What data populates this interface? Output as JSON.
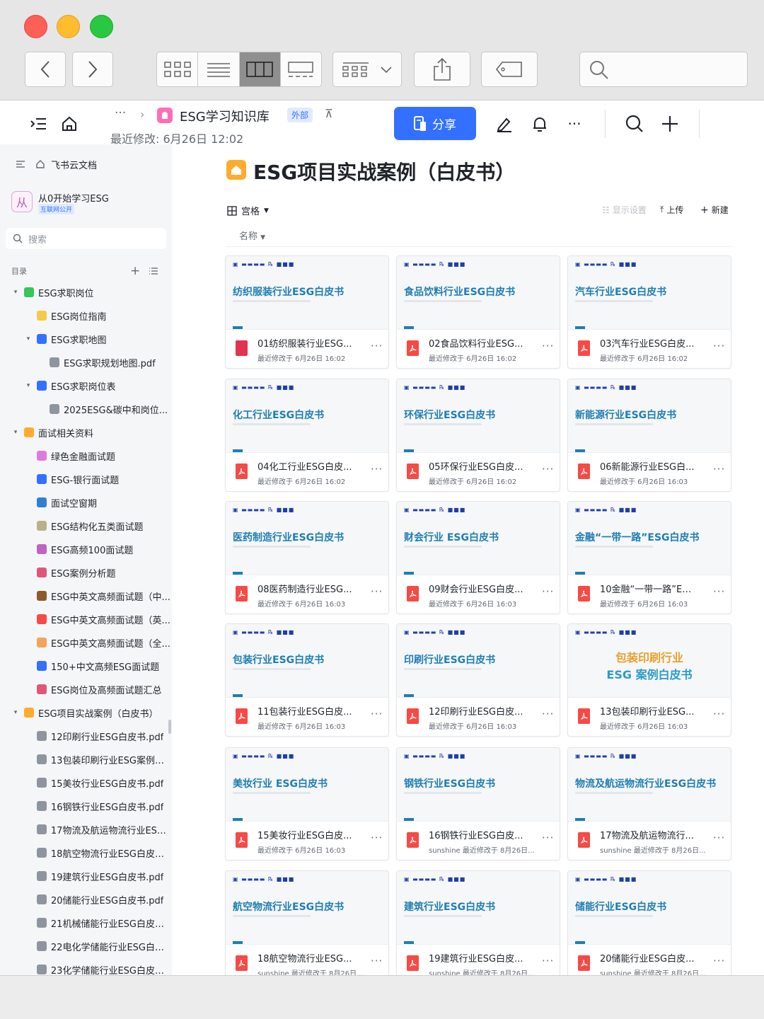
{
  "header": {
    "space_title": "ESG学习知识库",
    "external_tag": "外部",
    "last_modified": "最近修改: 6月26日 12:02",
    "share_label": "分享"
  },
  "sidebar": {
    "root_label": "飞书云文档",
    "space_name": "从0开始学习ESG",
    "space_tag": "互联网公开",
    "search_placeholder": "搜索",
    "toc_label": "目录",
    "items": [
      {
        "label": "ESG求职岗位",
        "level": 0,
        "caret": "▾",
        "color": "#34c759"
      },
      {
        "label": "ESG岗位指南",
        "level": 1,
        "caret": "",
        "color": "#f7c948"
      },
      {
        "label": "ESG求职地图",
        "level": 1,
        "caret": "▾",
        "color": "#3370ff"
      },
      {
        "label": "ESG求职规划地图.pdf",
        "level": 2,
        "caret": "",
        "color": "#8f959e"
      },
      {
        "label": "ESG求职岗位表",
        "level": 1,
        "caret": "▾",
        "color": "#3370ff"
      },
      {
        "label": "2025ESG&碳中和岗位...",
        "level": 2,
        "caret": "",
        "color": "#8f959e"
      },
      {
        "label": "面试相关资料",
        "level": 0,
        "caret": "▾",
        "color": "#ffab2e"
      },
      {
        "label": "绿色金融面试题",
        "level": 1,
        "caret": "",
        "color": "#e07bdb"
      },
      {
        "label": "ESG-银行面试题",
        "level": 1,
        "caret": "",
        "color": "#3370ff"
      },
      {
        "label": "面试空窗期",
        "level": 1,
        "caret": "",
        "color": "#2f7fd8"
      },
      {
        "label": "ESG结构化五类面试题",
        "level": 1,
        "caret": "",
        "color": "#b9b18a"
      },
      {
        "label": "ESG高频100面试题",
        "level": 1,
        "caret": "",
        "color": "#c062c4"
      },
      {
        "label": "ESG案例分析题",
        "level": 1,
        "caret": "",
        "color": "#e0567a"
      },
      {
        "label": "ESG中英文高频面试题（中...",
        "level": 1,
        "caret": "",
        "color": "#8c5a2b"
      },
      {
        "label": "ESG中英文高频面试题（英...",
        "level": 1,
        "caret": "",
        "color": "#f54a45"
      },
      {
        "label": "ESG中英文高频面试题（全...",
        "level": 1,
        "caret": "",
        "color": "#f3a35c"
      },
      {
        "label": "150+中文高频ESG面试题",
        "level": 1,
        "caret": "",
        "color": "#3370ff"
      },
      {
        "label": "ESG岗位及高频面试题汇总",
        "level": 1,
        "caret": "",
        "color": "#e0567a"
      },
      {
        "label": "ESG项目实战案例（白皮书）",
        "level": 0,
        "caret": "▾",
        "color": "#ffab2e"
      },
      {
        "label": "12印刷行业ESG白皮书.pdf",
        "level": 1,
        "caret": "",
        "color": "#8f959e"
      },
      {
        "label": "13包装印刷行业ESG案例白...",
        "level": 1,
        "caret": "",
        "color": "#8f959e"
      },
      {
        "label": "15美妆行业ESG白皮书.pdf",
        "level": 1,
        "caret": "",
        "color": "#8f959e"
      },
      {
        "label": "16钢铁行业ESG白皮书.pdf",
        "level": 1,
        "caret": "",
        "color": "#8f959e"
      },
      {
        "label": "17物流及航运物流行业ESG...",
        "level": 1,
        "caret": "",
        "color": "#8f959e"
      },
      {
        "label": "18航空物流行业ESG白皮书...",
        "level": 1,
        "caret": "",
        "color": "#8f959e"
      },
      {
        "label": "19建筑行业ESG白皮书.pdf",
        "level": 1,
        "caret": "",
        "color": "#8f959e"
      },
      {
        "label": "20储能行业ESG白皮书.pdf",
        "level": 1,
        "caret": "",
        "color": "#8f959e"
      },
      {
        "label": "21机械储能行业ESG白皮书...",
        "level": 1,
        "caret": "",
        "color": "#8f959e"
      },
      {
        "label": "22电化学储能行业ESG白皮...",
        "level": 1,
        "caret": "",
        "color": "#8f959e"
      },
      {
        "label": "23化学储能行业ESG白皮书...",
        "level": 1,
        "caret": "",
        "color": "#8f959e"
      }
    ]
  },
  "main": {
    "title": "ESG项目实战案例（白皮书）",
    "view_label": "宫格",
    "display_settings": "显示设置",
    "upload": "上传",
    "new": "新建",
    "sort_label": "名称",
    "cards": [
      {
        "preview_title": "纺织服装行业ESG白皮书",
        "name": "01纺织服装行业ESG...",
        "meta": "最近修改于 6月26日 16:02",
        "icon": "bar"
      },
      {
        "preview_title": "食品饮料行业ESG白皮书",
        "name": "02食品饮料行业ESG...",
        "meta": "最近修改于 6月26日 16:02",
        "icon": "pdf"
      },
      {
        "preview_title": "汽车行业ESG白皮书",
        "name": "03汽车行业ESG白皮...",
        "meta": "最近修改于 6月26日 16:02",
        "icon": "pdf"
      },
      {
        "preview_title": "化工行业ESG白皮书",
        "name": "04化工行业ESG白皮...",
        "meta": "最近修改于 6月26日 16:02",
        "icon": "pdf"
      },
      {
        "preview_title": "环保行业ESG白皮书",
        "name": "05环保行业ESG白皮...",
        "meta": "最近修改于 6月26日 16:02",
        "icon": "pdf"
      },
      {
        "preview_title": "新能源行业ESG白皮书",
        "name": "06新能源行业ESG白...",
        "meta": "最近修改于 6月26日 16:03",
        "icon": "pdf"
      },
      {
        "preview_title": "医药制造行业ESG白皮书",
        "name": "08医药制造行业ESG...",
        "meta": "最近修改于 6月26日 16:03",
        "icon": "pdf"
      },
      {
        "preview_title": "财会行业 ESG白皮书",
        "name": "09财会行业ESG白皮...",
        "meta": "最近修改于 6月26日 16:03",
        "icon": "pdf"
      },
      {
        "preview_title": "金融“一带一路”ESG白皮书",
        "name": "10金融“一带一路”ES...",
        "meta": "最近修改于 6月26日 16:03",
        "icon": "pdf"
      },
      {
        "preview_title": "包装行业ESG白皮书",
        "name": "11包装行业ESG白皮...",
        "meta": "最近修改于 6月26日 16:03",
        "icon": "pdf"
      },
      {
        "preview_title": "印刷行业ESG白皮书",
        "name": "12印刷行业ESG白皮...",
        "meta": "最近修改于 6月26日 16:03",
        "icon": "pdf"
      },
      {
        "preview_title": "包装印刷行业",
        "preview_title2": "ESG 案例白皮书",
        "name": "13包装印刷行业ESG...",
        "meta": "最近修改于 6月26日 16:03",
        "icon": "pdf"
      },
      {
        "preview_title": "美妆行业 ESG白皮书",
        "name": "15美妆行业ESG白皮...",
        "meta": "最近修改于 6月26日 16:03",
        "icon": "pdf"
      },
      {
        "preview_title": "钢铁行业ESG白皮书",
        "name": "16钢铁行业ESG白皮...",
        "meta": "sunshine 最近修改于 8月26日...",
        "icon": "pdf"
      },
      {
        "preview_title": "物流及航运物流行业ESG白皮书",
        "name": "17物流及航运物流行...",
        "meta": "sunshine 最近修改于 8月26日...",
        "icon": "pdf"
      },
      {
        "preview_title": "航空物流行业ESG白皮书",
        "name": "18航空物流行业ESG...",
        "meta": "sunshine 最近修改于 8月26日...",
        "icon": "pdf"
      },
      {
        "preview_title": "建筑行业ESG白皮书",
        "name": "19建筑行业ESG白皮...",
        "meta": "sunshine 最近修改于 8月26日...",
        "icon": "pdf"
      },
      {
        "preview_title": "储能行业ESG白皮书",
        "name": "20储能行业ESG白皮...",
        "meta": "sunshine 最近修改于 8月26日...",
        "icon": "pdf"
      }
    ]
  }
}
